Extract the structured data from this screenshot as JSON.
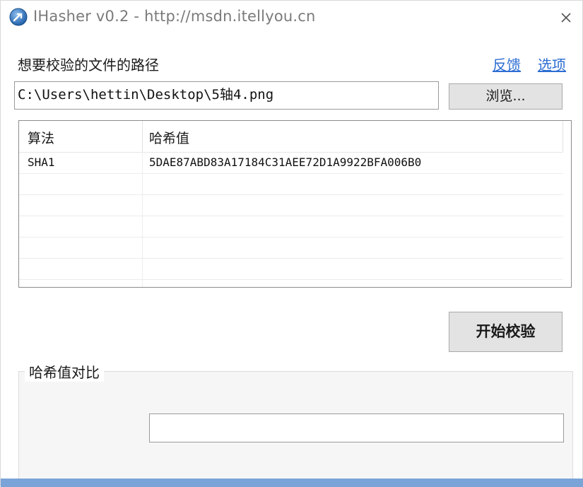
{
  "window": {
    "title": "IHasher v0.2 - http://msdn.itellyou.cn"
  },
  "path_section": {
    "label": "想要校验的文件的路径",
    "feedback_link": "反馈",
    "options_link": "选项",
    "path_value": "C:\\Users\\hettin\\Desktop\\5轴4.png",
    "browse_label": "浏览..."
  },
  "hash_list": {
    "columns": [
      "算法",
      "哈希值"
    ],
    "rows": [
      {
        "algorithm": "SHA1",
        "hash": "5DAE87ABD83A17184C31AEE72D1A9922BFA006B0"
      }
    ]
  },
  "actions": {
    "start_label": "开始校验"
  },
  "compare": {
    "group_title": "哈希值对比",
    "input_value": ""
  },
  "colors": {
    "link": "#2c6dd2",
    "button_bg": "#e3e3e3",
    "accent_strip": "#7aa4d8"
  }
}
